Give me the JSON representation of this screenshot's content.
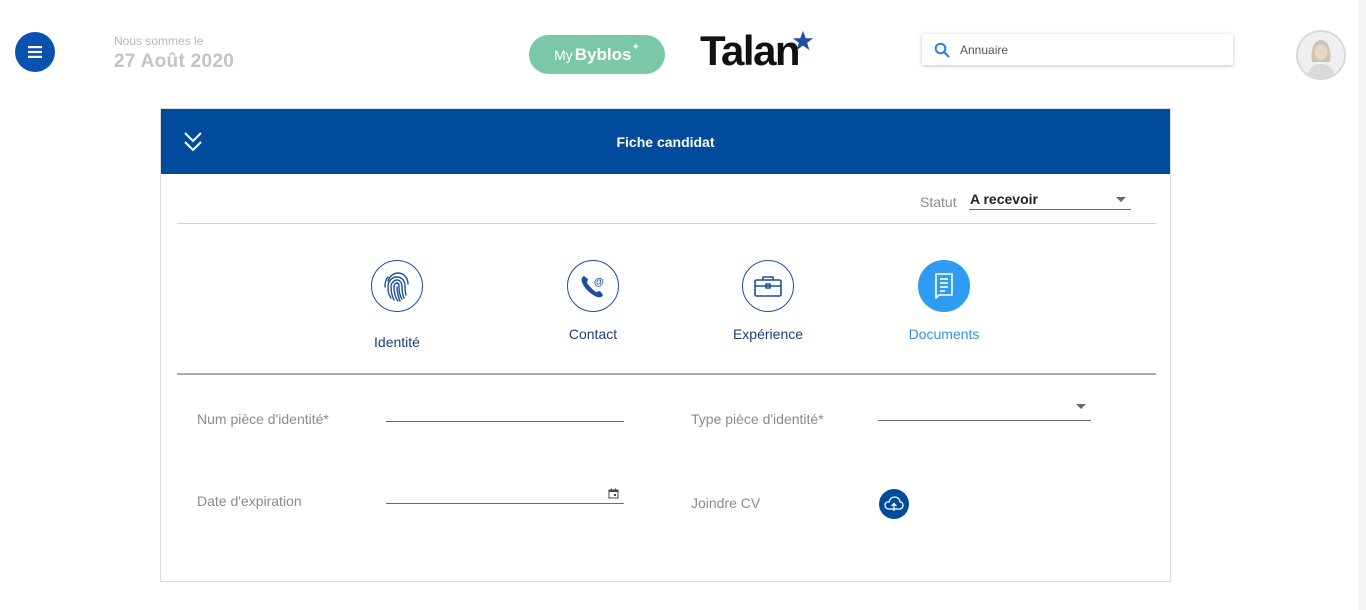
{
  "header": {
    "date_caption": "Nous sommes le",
    "date_value": "27 Août 2020",
    "app_my": "My",
    "app_byblos": "Byblos",
    "brand": "Talan",
    "search_placeholder": "Annuaire"
  },
  "card": {
    "title": "Fiche candidat",
    "status": {
      "label": "Statut",
      "value": "A recevoir"
    },
    "steps": [
      {
        "label": "Identité",
        "icon": "fingerprint-icon",
        "active": false
      },
      {
        "label": "Contact",
        "icon": "phone-at-icon",
        "active": false
      },
      {
        "label": "Expérience",
        "icon": "briefcase-icon",
        "active": false
      },
      {
        "label": "Documents",
        "icon": "document-icon",
        "active": true
      }
    ],
    "form": {
      "id_number_label": "Num pièce d'identité*",
      "id_number_value": "",
      "id_type_label": "Type pièce d'identité*",
      "id_type_value": "",
      "expiration_label": "Date d'expiration",
      "expiration_value": "",
      "attach_cv_label": "Joindre CV"
    }
  },
  "colors": {
    "primary": "#004b9c",
    "accent": "#2f9bf2",
    "mybyblos": "#7bc8a8",
    "star": "#1f4fa0"
  }
}
